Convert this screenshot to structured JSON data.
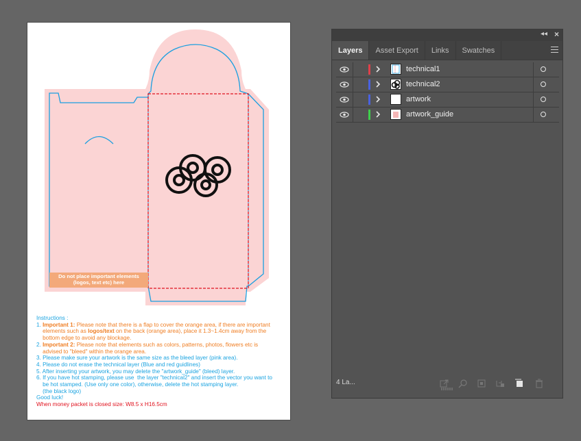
{
  "artboard": {
    "no_place_notice": "Do not place important elements (logos, text etc) here",
    "instructions": {
      "heading": "Instructions :",
      "line1a": "1. ",
      "line1b": "Important 1:",
      "line1c": " Please note that there is a flap to cover the orange area, if there are important",
      "line2a": "    elements such as ",
      "line2b": "logos/text",
      "line2c": " on the back (orange area), place it 1.3~1.4cm away from the",
      "line3": "    bottom edge to avoid any blockage.",
      "line4a": "2. ",
      "line4b": "Important 2:",
      "line4c": " Please note that elements such as colors, patterns, photos, flowers etc is",
      "line5": "    advised to \"bleed\" within the orange area.",
      "line6": "3. Please make sure your artwork is the same size as the bleed layer (pink area).",
      "line7": "4. Please do not erase the technical layer (Blue and red guidlines)",
      "line8": "5. After inserting your artwork, you may delete the \"artwork_guide\" (bleed) layer.",
      "line9": "6. If you have hot stamping, please use  the layer \"technical2\" and insert the vector you want to",
      "line10": "    be hot stamped. (Use only one color), otherwise, delete the hot stamping layer.",
      "line11": "    (the black logo)",
      "line12": "Good luck!",
      "line13": "When money packet is closed size: W8.5 x H16.5cm"
    }
  },
  "panel": {
    "tabs": [
      "Layers",
      "Asset Export",
      "Links",
      "Swatches"
    ],
    "layers": [
      {
        "name": "technical1",
        "color": "#e0404a"
      },
      {
        "name": "technical2",
        "color": "#4a62e0"
      },
      {
        "name": "artwork",
        "color": "#4a62e0"
      },
      {
        "name": "artwork_guide",
        "color": "#3fcf4c"
      }
    ],
    "layer_count": "4 La...",
    "colors": {
      "panel_bg": "#535353",
      "bleed_pink": "#fbd4d4",
      "dieline_blue": "#1a9fe0",
      "fold_red": "#e0111d",
      "warning_orange": "#f3a97a"
    }
  }
}
